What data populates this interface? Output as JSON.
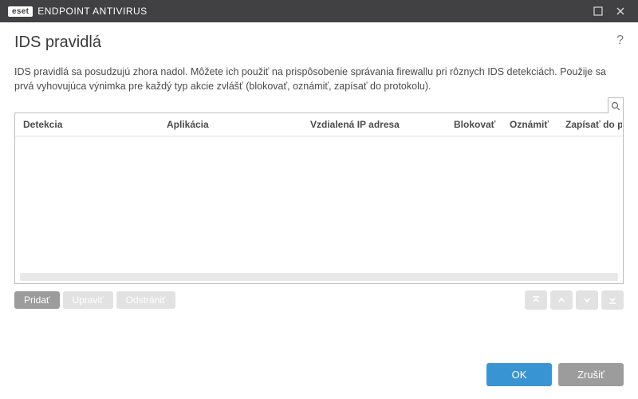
{
  "titlebar": {
    "brand_badge": "eset",
    "brand_text": "ENDPOINT ANTIVIRUS"
  },
  "header": {
    "title": "IDS pravidlá",
    "help_glyph": "?"
  },
  "description": "IDS pravidlá sa posudzujú zhora nadol. Môžete ich použiť na prispôsobenie správania firewallu pri rôznych IDS detekciách. Použije sa prvá vyhovujúca výnimka pre každý typ akcie zvlášť (blokovať, oznámiť, zapísať do protokolu).",
  "table": {
    "headers": {
      "detekcia": "Detekcia",
      "aplikacia": "Aplikácia",
      "ip": "Vzdialená IP adresa",
      "blokovat": "Blokovať",
      "oznamit": "Oznámiť",
      "zapisat": "Zapísať do protokolu"
    },
    "rows": []
  },
  "toolbar": {
    "add": "Pridať",
    "edit": "Upraviť",
    "delete": "Odstrániť"
  },
  "footer": {
    "ok": "OK",
    "cancel": "Zrušiť"
  }
}
